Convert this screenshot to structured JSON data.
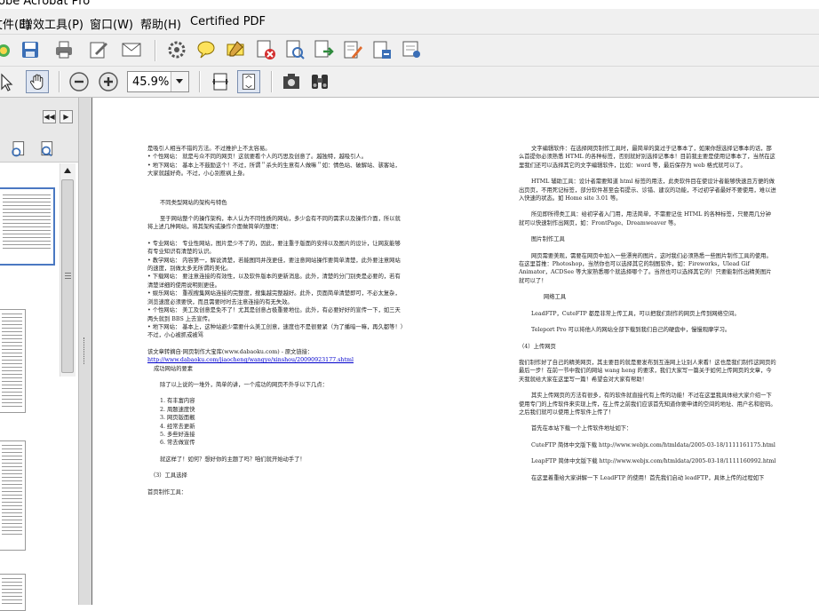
{
  "window": {
    "title": "obe Acrobat Pro"
  },
  "menu": [
    "文件(E)",
    "增效工具(P)",
    "窗口(W)",
    "帮助(H)",
    "Certified PDF"
  ],
  "toolbar": {
    "icons": [
      "create-pdf-icon",
      "save-icon",
      "print-icon",
      "sign-icon",
      "email-icon",
      "settings-icon",
      "comment-icon",
      "highlight-icon",
      "delete-pdf-icon",
      "search-document-icon",
      "export-icon",
      "edit-form-icon",
      "attach-icon",
      "secure-icon"
    ],
    "zoom_value": "45.9%"
  },
  "nav": {
    "prev": "◀◀",
    "next": "▶"
  },
  "doc": {
    "left": [
      "是吸引人相当不错的方法。不过推护上不太容易。",
      "• 个性网站：   就是与众不同的网页！这就要看个人的巧思及创意了。越独特，越吸引人。",
      "• 地下网站：   基本上不鼓励这个！不过，所谓＂杀头的生意有人做嘛＂如：情色站、破解站、骇客站，大家就越好奇。不过，小心别惹祸上身。",
      "不同类型网站的架构与特色",
      "至于网站整个的操作架构，本人认为不同性质的网站，多少会有不同的需求以及操作介面，所以就将上述几种网站，将其架构或操作介面做简单的整理：",
      "• 专业网站：  专业性网站，图片是少不了的，因此，要注重于版面的安排以及图片的设计，让网友能够有专业知识有清楚的认识。",
      "• 教学网站：  内容第一，解说清楚，若能图同并茂更佳，要注意网站操作要简单清楚，此外要注意网站的速度，别做太多无所谓的美化。",
      "• 下载网站：  要注意连接的有效性，以及软件版本的更新消息。此外，清楚的分门别类是必要的，若有清楚详细的使用说明则更佳。",
      "• 娱乐网站：  重视搜集网站连接的完整度，搜集越完整越好。此外，页面简单清楚即可，不必太复杂，浏览速度必须要快，而且需要时时去注意连接的有无失效。",
      "• 个性网站：  美工及创意是免不了！尤其是创意占极重要地位。此外，有必要好好的宣传一下，如三天两头就到 BBS 上去宣传。",
      "• 地下网站：  基本上，这种站避少需要什么美工创意，速度也不是很要紧（为了播暗一嘛，再久都等！）不过，小心被抓或被骂",
      "该文章转摘自·网页制作大宝库(www.dabaoku.com) - 原文链接：",
      "http://www.dabaoku.com/jiaocheng/wangye/xinshou/20090923177.shtml",
      "成功网站的要素",
      "除了以上说的一堆外，简单的讲，一个成功的网页不外乎以下几点：",
      "1. 有丰富内容",
      "2. 周题速度快",
      "3. 网页版面靓",
      "4. 经常去更新",
      "5. 多些好连接",
      "6. 常去做宣传",
      "就这样了！如何？想好你的主题了吗？咱们就开始动手了！",
      "（3）工具选择",
      "首页制作工具："
    ],
    "right": [
      "文字编辑软件：在选择网页制作工具时，最简单的莫过于记事本了，如果你想选择记事本的话，那么首提你必须熟悉 HTML 的各种标签，否则就好别选择记事本！目前我主要是使用记事本了，当然在这里我们还可以选择其它的文字编辑软件，比如：word 等，最后保存为 web 格式就可以了。",
      "HTML 辅助工具：设计者需要知道 html 标签的用法，此类软件目在使设计者能够快速且方便的做出页页，不用死记标签，部分软件甚至会有提示、诊错、建议的功能，不过初学者最好不要使用，难以进入快速的状态。如 Home site 3.01 等。",
      "所见即所得类工具：给初学者入门用，用法简单，不需要记住 HTML 的各种标签，只要用几分钟就可以快速制作出网页，如：FrontPage、Dreamweaver 等。",
      "图片制作工具",
      "网页需要美观，需要在网页中加入一些漂亮的图片，这时我们必须熟悉一些图片制作工具的使用。在这里首推：Photoshop，当然你也可以选择其它的制图软件，如：Fireworks，Ulead Gif Animator，ACDSee 等大家熟悉哪个就选择哪个了。当然也可以选择其它的！只要能制作出精美图片就可以了！",
      "网络工具",
      "LeadFTP，CuteFTP 都是非常上传工具，可以把我们制作的网页上传到网络空间。",
      "Teleport Pro 可以将他人的网站全部下载到我们自己的硬盘中，慢慢观摩学习。",
      "（4）上传网页",
      "我们制作好了自己的精美网页，其主要目的就是要发布到互连网上让别人来看！这也是我们制作这网页的最后一步！在前一节中我们的网站 wang heng 的要求，我们大家写一篇关于如何上传网页的文章，今天我就给大家在这里写一篇！希望会对大家有帮助！",
      "其实上传网页的方法有很多，有的软件就直接代有上传的功能！不过在这里我具体给大家介绍一下使用专门的上传软件来实现上传，在上传之前我们应该首先知道你要申请的空间的地址、用户名和密码。之后我们就可以使用上传软件上传了！",
      "首先在本站下载一个上传软件地址如下：",
      "CuteFTP 简体中文版下载  http://www.webjx.com/htmldata/2005-03-18/1111161175.html",
      "LeapFTP 简体中文版下载  http://www.webjx.com/htmldata/2005-03-18/1111160992.html",
      "在这里着重给大家讲解一下 LeadFTP 的使用！首先我们启动 leadFTP，具体上传的过程如下"
    ]
  }
}
